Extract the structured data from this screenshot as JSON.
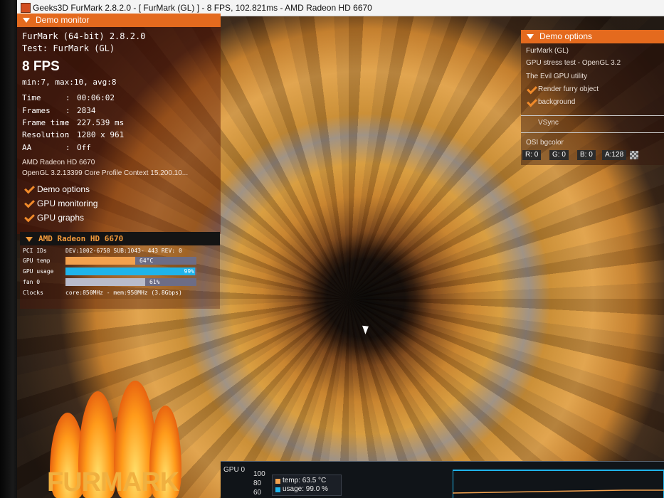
{
  "window": {
    "title": "Geeks3D FurMark 2.8.2.0 - [ FurMark (GL) ] - 8 FPS, 102.821ms - AMD Radeon HD 6670"
  },
  "demo_monitor": {
    "header": "Demo monitor",
    "app_version": "FurMark (64-bit) 2.8.2.0",
    "test": "Test: FurMark (GL)",
    "fps": "8 FPS",
    "fps_stats": "min:7, max:10, avg:8",
    "stats": [
      {
        "label": "Time",
        "value": "00:06:02"
      },
      {
        "label": "Frames",
        "value": "2834"
      },
      {
        "label": "Frame time",
        "value": "227.539 ms"
      },
      {
        "label": "Resolution",
        "value": "1280 x 961"
      },
      {
        "label": "AA",
        "value": "Off"
      }
    ],
    "gpu_name": "AMD Radeon HD 6670",
    "opengl": "OpenGL 3.2.13399 Core Profile Context 15.200.10...",
    "toggles": [
      {
        "label": "Demo options",
        "checked": true
      },
      {
        "label": "GPU monitoring",
        "checked": true
      },
      {
        "label": "GPU graphs",
        "checked": true
      }
    ]
  },
  "gpu_panel": {
    "header": "AMD Radeon HD 6670",
    "pci_label": "PCI IDs",
    "pci_value": "DEV:1002-6758 SUB:1043- 443 REV: 0",
    "temp_label": "GPU temp",
    "temp_text": "64°C",
    "temp_level": 0.53,
    "usage_label": "GPU usage",
    "usage_text": "99%",
    "usage_level": 0.99,
    "fan_label": "fan 0",
    "fan_text": "61%",
    "fan_level": 0.61,
    "clocks_label": "Clocks",
    "clocks_value": "core:850MHz - mem:950MHz (3.8Gbps)",
    "colors": {
      "temp": "#f2a14e",
      "usage": "#1fb4ea",
      "fan": "#b9bccb",
      "track": "#6d6d86"
    }
  },
  "demo_options": {
    "header": "Demo options",
    "line1": "FurMark (GL)",
    "line2": "GPU stress test - OpenGL 3.2",
    "line3": "The Evil GPU utility",
    "opt_render": "Render furry object",
    "opt_background": "background",
    "vsync": "VSync",
    "bgcolor_label": "OSI bgcolor",
    "r": "R: 0",
    "g": "G: 0",
    "b": "B: 0",
    "a": "A:128"
  },
  "gpu_graph": {
    "title": "GPU 0",
    "y100": "100",
    "y80": "80",
    "y60": "60",
    "legend_temp": "temp: 63.5 °C",
    "legend_usage": "usage: 99.0 %",
    "colors": {
      "temp": "#f2a14e",
      "usage": "#1fb4ea"
    }
  },
  "logo": {
    "text": "FURMARK"
  }
}
